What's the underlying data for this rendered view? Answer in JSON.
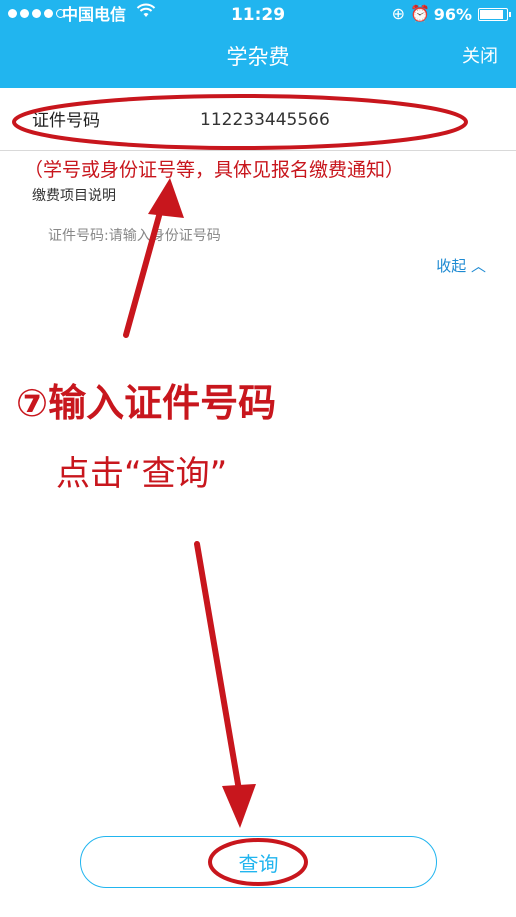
{
  "status_bar": {
    "carrier": "中国电信",
    "time": "11:29",
    "battery": "96%",
    "battery_level": 0.96,
    "icons": [
      "signal-dots-icon",
      "wifi-icon",
      "rotation-lock-icon",
      "alarm-icon",
      "battery-icon"
    ]
  },
  "header": {
    "title": "学杂费",
    "close_label": "关闭"
  },
  "form": {
    "id_label": "证件号码",
    "id_value": "112233445566",
    "fee_desc": "缴费项目说明",
    "hint": "证件号码:请输入身份证号码",
    "collapse_label": "收起"
  },
  "annotations": {
    "note": "（学号或身份证号等，具体见报名缴费通知）",
    "step": "⑦输入证件号码",
    "instruction": "点击“查询”",
    "color": "#c8161d"
  },
  "query_button": {
    "label": "查询"
  },
  "colors": {
    "header_bg": "#21b5ef",
    "link": "#1e8ad2",
    "annotation": "#c8161d"
  }
}
